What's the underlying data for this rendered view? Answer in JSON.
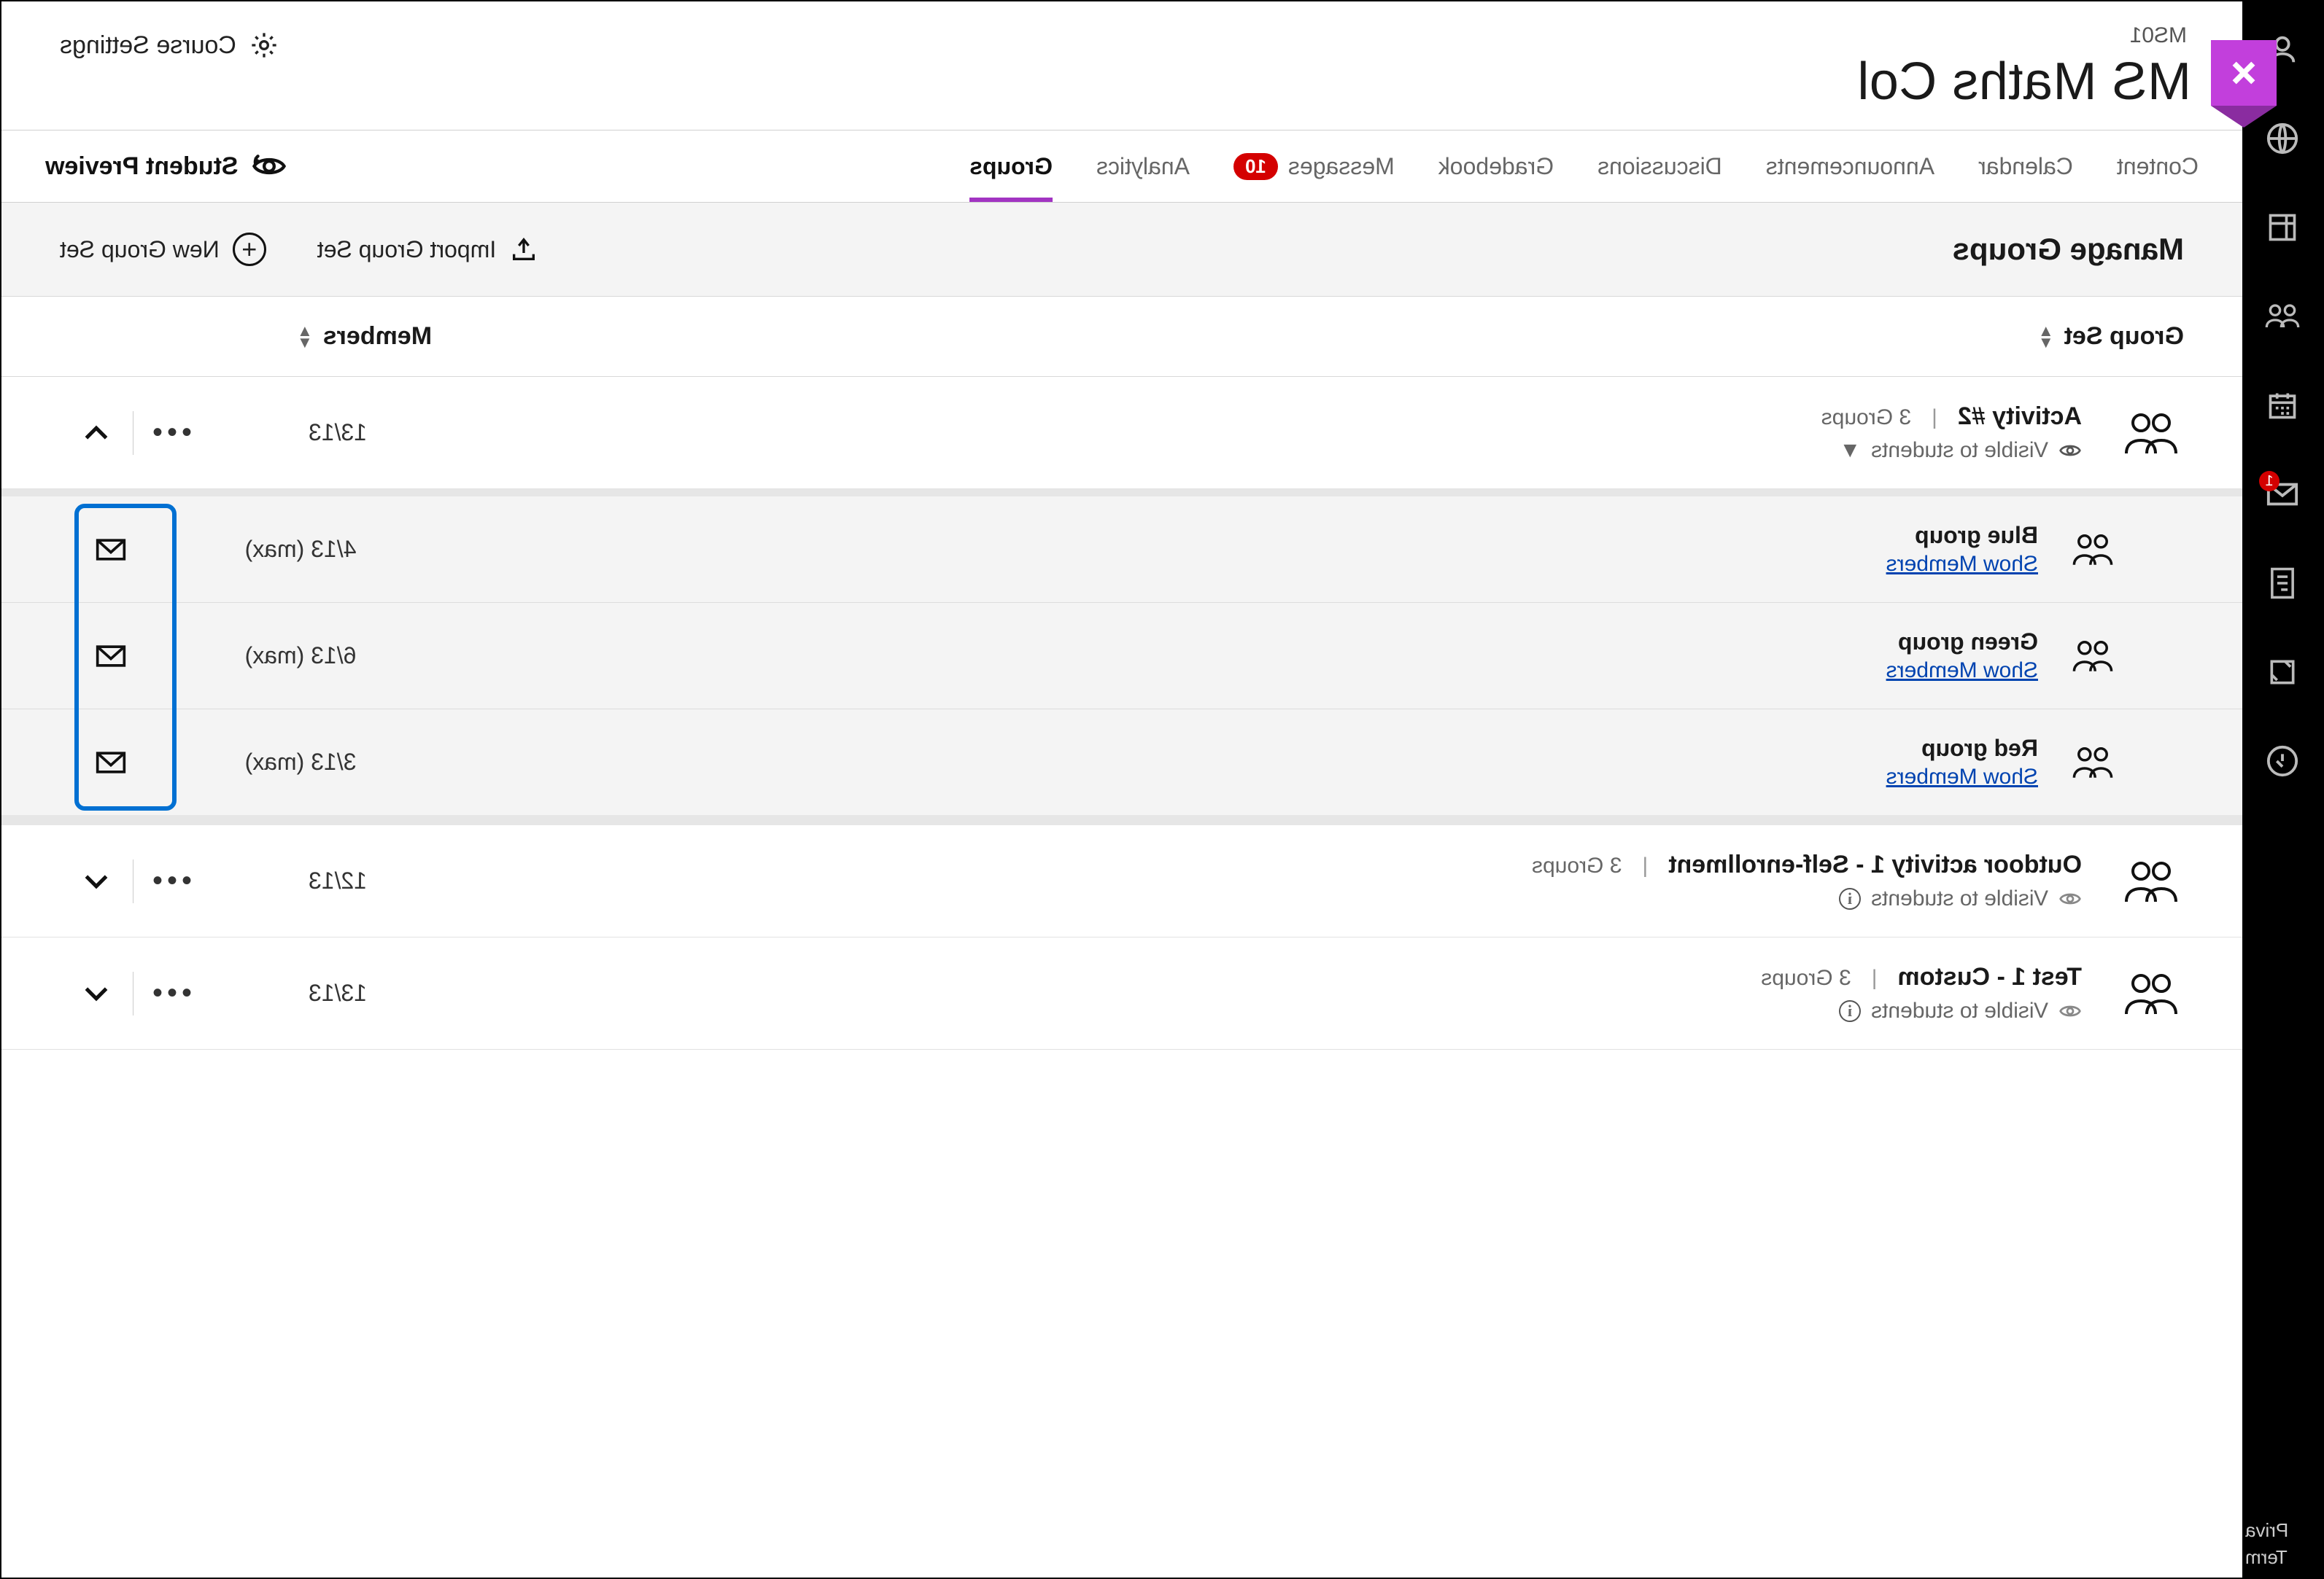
{
  "course": {
    "code": "MS01",
    "title": "MS Maths Col"
  },
  "header_settings": "Course Settings",
  "tabs": {
    "content": "Content",
    "calendar": "Calendar",
    "announcements": "Announcements",
    "discussions": "Discussions",
    "gradebook": "Gradebook",
    "messages": "Messages",
    "messages_badge": "10",
    "analytics": "Analytics",
    "groups": "Groups",
    "student_preview": "Student Preview"
  },
  "toolbar": {
    "title": "Manage Groups",
    "import": "Import Group Set",
    "new": "New Group Set"
  },
  "thead": {
    "group_set": "Group Set",
    "members": "Members"
  },
  "rail": {
    "msg_badge": "1",
    "footer1": "Priva",
    "footer2": "Term"
  },
  "sets": [
    {
      "name": "Activity #2",
      "groups_label": "3 Groups",
      "visibility": "Visible to students",
      "members": "13/13",
      "expanded": true,
      "show_caret": true,
      "children": [
        {
          "name": "Blue group",
          "link": "Show Members",
          "members": "4/13 (max)"
        },
        {
          "name": "Green group",
          "link": "Show Members",
          "members": "6/13 (max)"
        },
        {
          "name": "Red group",
          "link": "Show Members",
          "members": "3/13 (max)"
        }
      ]
    },
    {
      "name": "Outdoor activity 1 - Self-enrollment",
      "groups_label": "3 Groups",
      "visibility": "Visible to students",
      "members": "12/13",
      "expanded": false,
      "show_info": true
    },
    {
      "name": "Test 1 - Custom",
      "groups_label": "3 Groups",
      "visibility": "Visible to students",
      "members": "13/13",
      "expanded": false,
      "show_info": true
    }
  ]
}
